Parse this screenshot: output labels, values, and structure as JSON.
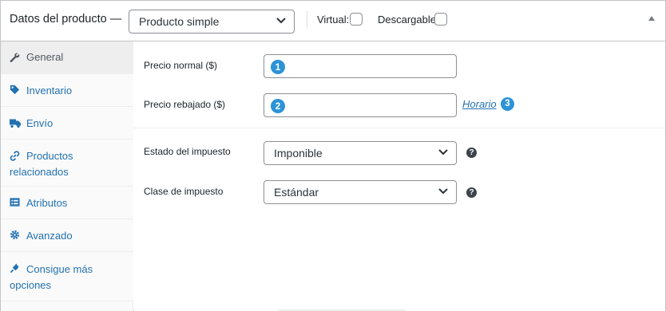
{
  "header": {
    "title": "Datos del producto —",
    "product_type": "Producto simple",
    "virtual_label": "Virtual:",
    "downloadable_label": "Descargable:"
  },
  "sidebar": {
    "items": [
      {
        "label_first": "General",
        "label_rest": "",
        "icon": "wrench-icon",
        "active": true
      },
      {
        "label_first": "Inventario",
        "label_rest": "",
        "icon": "tag-icon",
        "active": false
      },
      {
        "label_first": "Envío",
        "label_rest": "",
        "icon": "truck-icon",
        "active": false
      },
      {
        "label_first": "Productos",
        "label_rest": "relacionados",
        "icon": "link-icon",
        "active": false
      },
      {
        "label_first": "Atributos",
        "label_rest": "",
        "icon": "list-icon",
        "active": false
      },
      {
        "label_first": "Avanzado",
        "label_rest": "",
        "icon": "gear-icon",
        "active": false
      },
      {
        "label_first": "Consigue más",
        "label_rest": "opciones",
        "icon": "plugin-icon",
        "active": false
      }
    ]
  },
  "general": {
    "regular_price_label": "Precio normal ($)",
    "sale_price_label": "Precio rebajado ($)",
    "schedule_link": "Horario",
    "badges": [
      "1",
      "2",
      "3"
    ],
    "tax_status_label": "Estado del impuesto",
    "tax_status_value": "Imponible",
    "tax_class_label": "Clase de impuesto",
    "tax_class_value": "Estándar",
    "help_glyph": "?"
  },
  "colors": {
    "link": "#2271b1",
    "badge": "#2c93d6",
    "border": "#c3c4c7",
    "sidebar_bg": "#fafafa",
    "active_tab_bg": "#eeeeee"
  }
}
